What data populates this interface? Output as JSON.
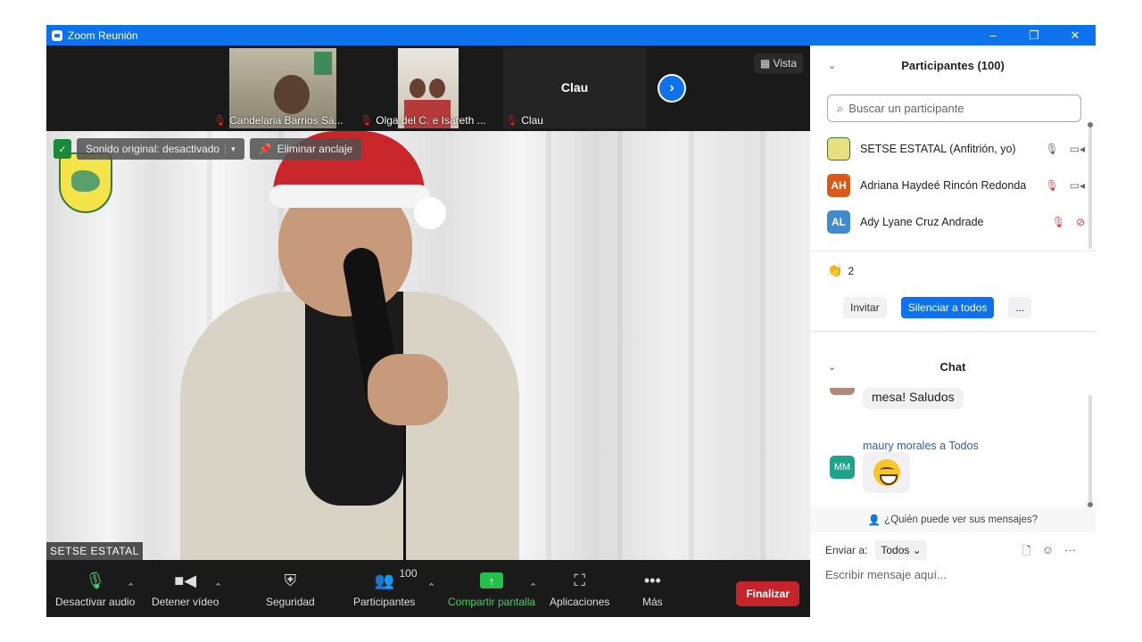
{
  "window": {
    "title": "Zoom Reunión",
    "min": "–",
    "restore": "❐",
    "close": "✕"
  },
  "thumbnails": [
    {
      "name": "Candelaria Barrios Sá..."
    },
    {
      "name": "Olga del C. e Isareth ..."
    },
    {
      "name": "Clau",
      "center_label": "Clau"
    }
  ],
  "view_button": "Vista",
  "main_video": {
    "sound_pill": "Sonido original: desactivado",
    "unpin_pill": "Eliminar anclaje",
    "name_tag": "SETSE ESTATAL"
  },
  "toolbar": {
    "audio": "Desactivar audio",
    "video": "Detener vídeo",
    "security": "Seguridad",
    "participants": "Participantes",
    "participants_count": "100",
    "share": "Compartir pantalla",
    "apps": "Aplicaciones",
    "more": "Más",
    "end": "Finalizar"
  },
  "participants_panel": {
    "title": "Participantes (100)",
    "search_placeholder": "Buscar un participante",
    "items": [
      {
        "initials": "",
        "name": "SETSE ESTATAL (Anfitrión, yo)",
        "color": "#d9c84a"
      },
      {
        "initials": "AH",
        "name": "Adriana Haydeé Rincón Redonda",
        "color": "#d9581a"
      },
      {
        "initials": "AL",
        "name": "Ady Lyane Cruz Andrade",
        "color": "#3f8ad0"
      }
    ],
    "raised_hands": "2",
    "invite": "Invitar",
    "mute_all": "Silenciar a todos",
    "more": "..."
  },
  "chat": {
    "title": "Chat",
    "prev_message_tail": "mesa! Saludos",
    "sender": "maury morales",
    "to_word": "a",
    "recipient": "Todos",
    "sender_initials": "MM",
    "who_can_see": "¿Quién puede ver sus mensajes?",
    "send_to_label": "Enviar a:",
    "send_to_value": "Todos",
    "input_placeholder": "Escribir mensaje aquí..."
  }
}
